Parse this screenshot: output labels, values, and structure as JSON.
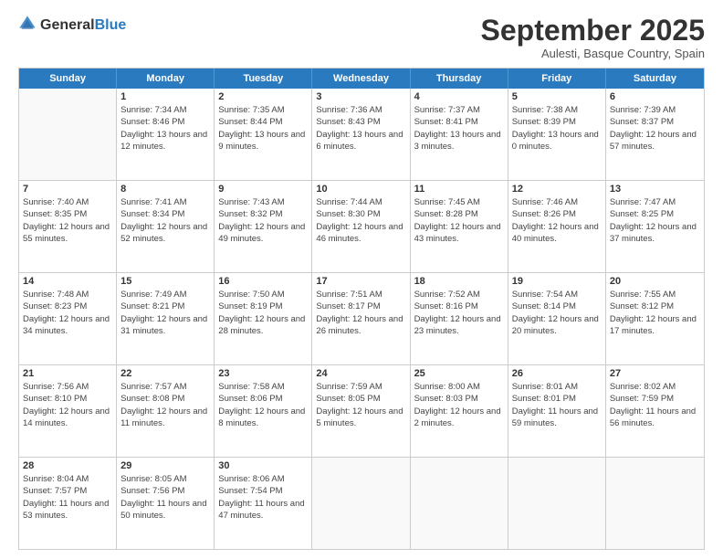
{
  "header": {
    "logo_general": "General",
    "logo_blue": "Blue",
    "month_title": "September 2025",
    "subtitle": "Aulesti, Basque Country, Spain"
  },
  "calendar": {
    "days_of_week": [
      "Sunday",
      "Monday",
      "Tuesday",
      "Wednesday",
      "Thursday",
      "Friday",
      "Saturday"
    ],
    "rows": [
      [
        {
          "day": "",
          "sunrise": "",
          "sunset": "",
          "daylight": ""
        },
        {
          "day": "1",
          "sunrise": "Sunrise: 7:34 AM",
          "sunset": "Sunset: 8:46 PM",
          "daylight": "Daylight: 13 hours and 12 minutes."
        },
        {
          "day": "2",
          "sunrise": "Sunrise: 7:35 AM",
          "sunset": "Sunset: 8:44 PM",
          "daylight": "Daylight: 13 hours and 9 minutes."
        },
        {
          "day": "3",
          "sunrise": "Sunrise: 7:36 AM",
          "sunset": "Sunset: 8:43 PM",
          "daylight": "Daylight: 13 hours and 6 minutes."
        },
        {
          "day": "4",
          "sunrise": "Sunrise: 7:37 AM",
          "sunset": "Sunset: 8:41 PM",
          "daylight": "Daylight: 13 hours and 3 minutes."
        },
        {
          "day": "5",
          "sunrise": "Sunrise: 7:38 AM",
          "sunset": "Sunset: 8:39 PM",
          "daylight": "Daylight: 13 hours and 0 minutes."
        },
        {
          "day": "6",
          "sunrise": "Sunrise: 7:39 AM",
          "sunset": "Sunset: 8:37 PM",
          "daylight": "Daylight: 12 hours and 57 minutes."
        }
      ],
      [
        {
          "day": "7",
          "sunrise": "Sunrise: 7:40 AM",
          "sunset": "Sunset: 8:35 PM",
          "daylight": "Daylight: 12 hours and 55 minutes."
        },
        {
          "day": "8",
          "sunrise": "Sunrise: 7:41 AM",
          "sunset": "Sunset: 8:34 PM",
          "daylight": "Daylight: 12 hours and 52 minutes."
        },
        {
          "day": "9",
          "sunrise": "Sunrise: 7:43 AM",
          "sunset": "Sunset: 8:32 PM",
          "daylight": "Daylight: 12 hours and 49 minutes."
        },
        {
          "day": "10",
          "sunrise": "Sunrise: 7:44 AM",
          "sunset": "Sunset: 8:30 PM",
          "daylight": "Daylight: 12 hours and 46 minutes."
        },
        {
          "day": "11",
          "sunrise": "Sunrise: 7:45 AM",
          "sunset": "Sunset: 8:28 PM",
          "daylight": "Daylight: 12 hours and 43 minutes."
        },
        {
          "day": "12",
          "sunrise": "Sunrise: 7:46 AM",
          "sunset": "Sunset: 8:26 PM",
          "daylight": "Daylight: 12 hours and 40 minutes."
        },
        {
          "day": "13",
          "sunrise": "Sunrise: 7:47 AM",
          "sunset": "Sunset: 8:25 PM",
          "daylight": "Daylight: 12 hours and 37 minutes."
        }
      ],
      [
        {
          "day": "14",
          "sunrise": "Sunrise: 7:48 AM",
          "sunset": "Sunset: 8:23 PM",
          "daylight": "Daylight: 12 hours and 34 minutes."
        },
        {
          "day": "15",
          "sunrise": "Sunrise: 7:49 AM",
          "sunset": "Sunset: 8:21 PM",
          "daylight": "Daylight: 12 hours and 31 minutes."
        },
        {
          "day": "16",
          "sunrise": "Sunrise: 7:50 AM",
          "sunset": "Sunset: 8:19 PM",
          "daylight": "Daylight: 12 hours and 28 minutes."
        },
        {
          "day": "17",
          "sunrise": "Sunrise: 7:51 AM",
          "sunset": "Sunset: 8:17 PM",
          "daylight": "Daylight: 12 hours and 26 minutes."
        },
        {
          "day": "18",
          "sunrise": "Sunrise: 7:52 AM",
          "sunset": "Sunset: 8:16 PM",
          "daylight": "Daylight: 12 hours and 23 minutes."
        },
        {
          "day": "19",
          "sunrise": "Sunrise: 7:54 AM",
          "sunset": "Sunset: 8:14 PM",
          "daylight": "Daylight: 12 hours and 20 minutes."
        },
        {
          "day": "20",
          "sunrise": "Sunrise: 7:55 AM",
          "sunset": "Sunset: 8:12 PM",
          "daylight": "Daylight: 12 hours and 17 minutes."
        }
      ],
      [
        {
          "day": "21",
          "sunrise": "Sunrise: 7:56 AM",
          "sunset": "Sunset: 8:10 PM",
          "daylight": "Daylight: 12 hours and 14 minutes."
        },
        {
          "day": "22",
          "sunrise": "Sunrise: 7:57 AM",
          "sunset": "Sunset: 8:08 PM",
          "daylight": "Daylight: 12 hours and 11 minutes."
        },
        {
          "day": "23",
          "sunrise": "Sunrise: 7:58 AM",
          "sunset": "Sunset: 8:06 PM",
          "daylight": "Daylight: 12 hours and 8 minutes."
        },
        {
          "day": "24",
          "sunrise": "Sunrise: 7:59 AM",
          "sunset": "Sunset: 8:05 PM",
          "daylight": "Daylight: 12 hours and 5 minutes."
        },
        {
          "day": "25",
          "sunrise": "Sunrise: 8:00 AM",
          "sunset": "Sunset: 8:03 PM",
          "daylight": "Daylight: 12 hours and 2 minutes."
        },
        {
          "day": "26",
          "sunrise": "Sunrise: 8:01 AM",
          "sunset": "Sunset: 8:01 PM",
          "daylight": "Daylight: 11 hours and 59 minutes."
        },
        {
          "day": "27",
          "sunrise": "Sunrise: 8:02 AM",
          "sunset": "Sunset: 7:59 PM",
          "daylight": "Daylight: 11 hours and 56 minutes."
        }
      ],
      [
        {
          "day": "28",
          "sunrise": "Sunrise: 8:04 AM",
          "sunset": "Sunset: 7:57 PM",
          "daylight": "Daylight: 11 hours and 53 minutes."
        },
        {
          "day": "29",
          "sunrise": "Sunrise: 8:05 AM",
          "sunset": "Sunset: 7:56 PM",
          "daylight": "Daylight: 11 hours and 50 minutes."
        },
        {
          "day": "30",
          "sunrise": "Sunrise: 8:06 AM",
          "sunset": "Sunset: 7:54 PM",
          "daylight": "Daylight: 11 hours and 47 minutes."
        },
        {
          "day": "",
          "sunrise": "",
          "sunset": "",
          "daylight": ""
        },
        {
          "day": "",
          "sunrise": "",
          "sunset": "",
          "daylight": ""
        },
        {
          "day": "",
          "sunrise": "",
          "sunset": "",
          "daylight": ""
        },
        {
          "day": "",
          "sunrise": "",
          "sunset": "",
          "daylight": ""
        }
      ]
    ]
  }
}
